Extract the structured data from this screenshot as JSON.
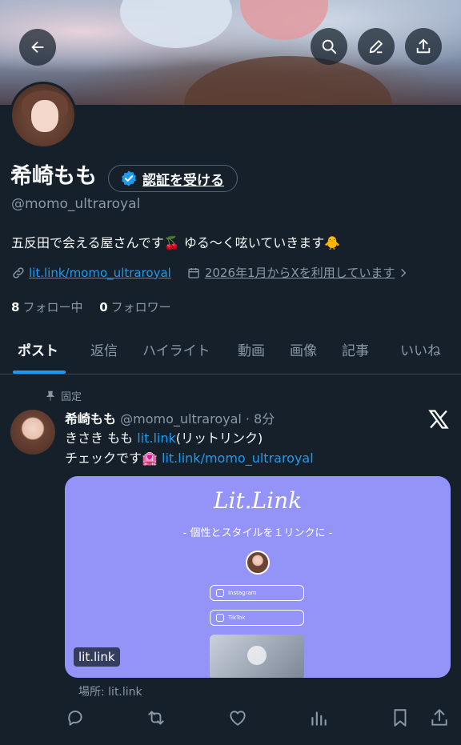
{
  "profile": {
    "name": "希崎もも",
    "verify_label": "認証を受ける",
    "handle": "@momo_ultraroyal",
    "bio": "五反田で会える屋さんです🍒 ゆる〜く呟いていきます🐥",
    "link": "lit.link/momo_ultraroyal",
    "joined": "2026年1月からXを利用しています",
    "following_count": "8",
    "following_label": "フォロー中",
    "followers_count": "0",
    "followers_label": "フォロワー"
  },
  "tabs": [
    {
      "label": "ポスト",
      "active": true
    },
    {
      "label": "返信"
    },
    {
      "label": "ハイライト"
    },
    {
      "label": "動画"
    },
    {
      "label": "画像"
    },
    {
      "label": "記事"
    },
    {
      "label": "いいね"
    }
  ],
  "post": {
    "pinned_label": "固定",
    "author": "希崎もも",
    "handle_time": "@momo_ultraroyal · 8分",
    "line1_prefix": "きさき もも ",
    "line1_link": "lit.link",
    "line1_suffix": "(リットリンク)",
    "line2_prefix": "チェックです🏩 ",
    "line2_link": "lit.link/momo_ultraroyal",
    "card": {
      "logo": "Lit.Link",
      "tagline": "- 個性とスタイルを１リンクに -",
      "pill1": "Instagram",
      "pill2": "TikTok",
      "domain": "lit.link"
    },
    "location": "場所: lit.link"
  },
  "icons": [
    "back-arrow-icon",
    "search-icon",
    "edit-icon",
    "share-icon",
    "verified-badge-icon",
    "link-icon",
    "calendar-icon",
    "chevron-right-icon",
    "pin-icon",
    "x-logo-icon",
    "reply-icon",
    "repost-icon",
    "like-icon",
    "views-icon",
    "bookmark-icon"
  ],
  "colors": {
    "accent": "#1d9bf0",
    "background": "#15202b",
    "muted": "#8b98a5",
    "card": "#9493f7"
  }
}
